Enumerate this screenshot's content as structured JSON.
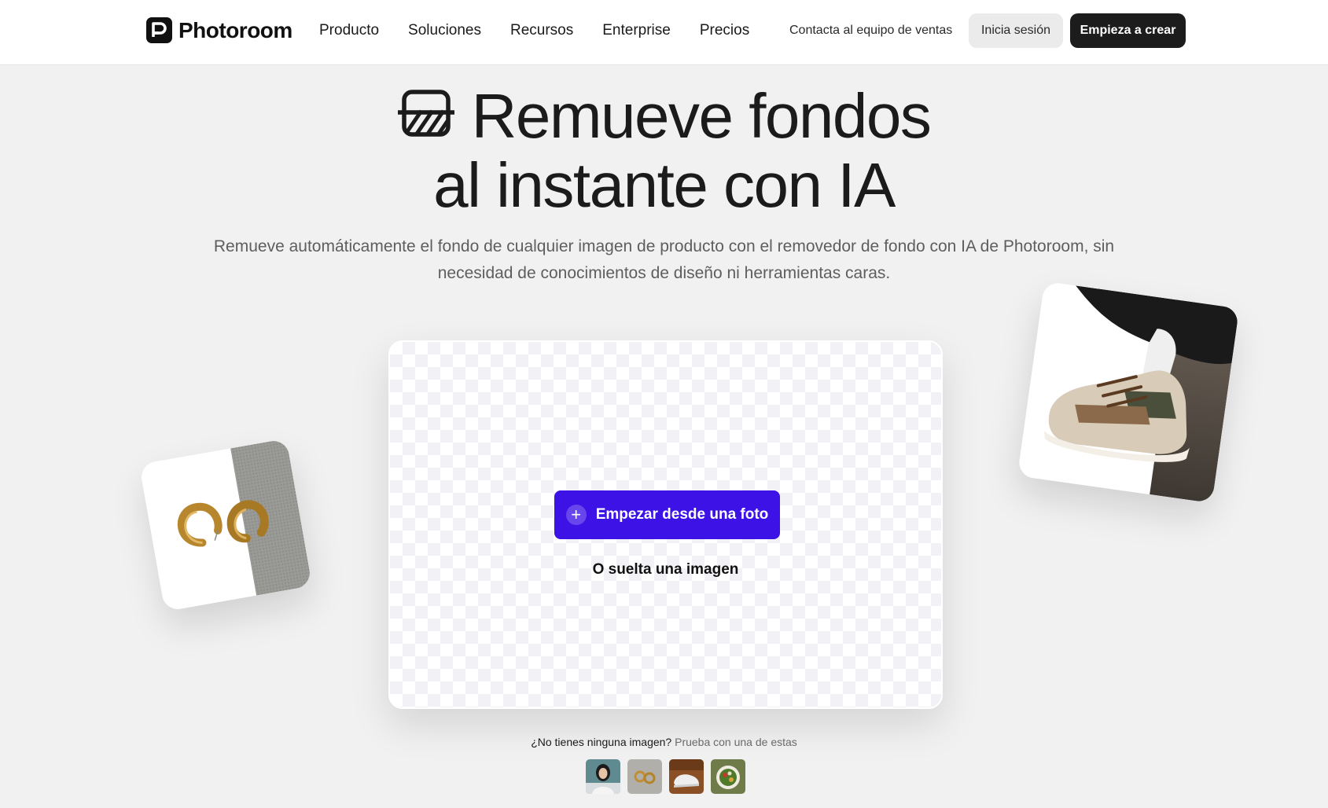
{
  "header": {
    "brand": "Photoroom",
    "nav": [
      "Producto",
      "Soluciones",
      "Recursos",
      "Enterprise",
      "Precios"
    ],
    "contact_label": "Contacta al equipo de ventas",
    "login_label": "Inicia sesión",
    "cta_label": "Empieza a crear"
  },
  "hero": {
    "title_line1": "Remueve fondos",
    "title_line2": "al instante con IA",
    "subtitle": "Remueve automáticamente el fondo de cualquier imagen de producto con el removedor de fondo con IA de Photoroom, sin necesidad de conocimientos de diseño ni herramientas caras."
  },
  "upload": {
    "button_label": "Empezar desde una foto",
    "drop_label": "O suelta una imagen"
  },
  "samples": {
    "question": "¿No tienes ninguna imagen?",
    "hint": "Prueba con una de estas",
    "thumbnails": [
      "sample-woman",
      "sample-earrings",
      "sample-sneakers",
      "sample-salad"
    ]
  },
  "colors": {
    "accent": "#3d12e6",
    "dark_button": "#1c1c1c",
    "page_bg": "#f1f1f1"
  },
  "icons": [
    "photoroom-logo-icon",
    "remove-background-icon",
    "plus-icon"
  ]
}
